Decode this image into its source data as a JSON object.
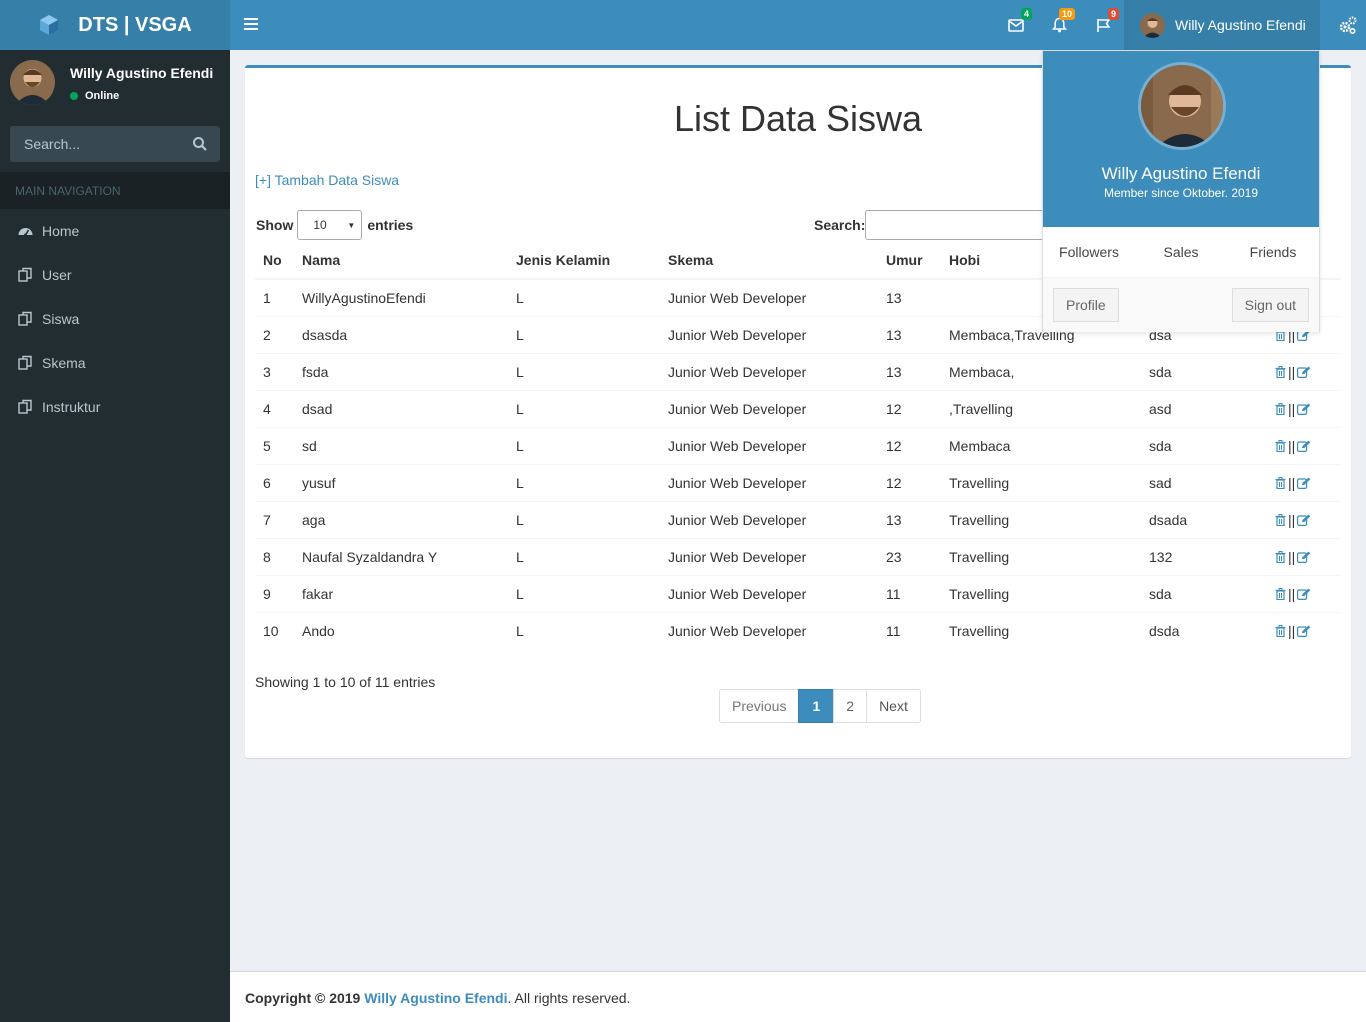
{
  "brand": {
    "title": "DTS | VSGA"
  },
  "header": {
    "badges": {
      "mail": "4",
      "notifications": "10",
      "tasks": "9"
    },
    "user_name": "Willy Agustino Efendi"
  },
  "sidebar": {
    "user_name": "Willy Agustino Efendi",
    "status": "Online",
    "search_placeholder": "Search...",
    "nav_header": "MAIN NAVIGATION",
    "items": [
      {
        "label": "Home",
        "icon": "dashboard-icon"
      },
      {
        "label": "User",
        "icon": "copy-icon"
      },
      {
        "label": "Siswa",
        "icon": "copy-icon"
      },
      {
        "label": "Skema",
        "icon": "copy-icon"
      },
      {
        "label": "Instruktur",
        "icon": "copy-icon"
      }
    ]
  },
  "main": {
    "title": "List Data Siswa",
    "add_link": "[+] Tambah Data Siswa",
    "show_label": "Show",
    "entries_value": "10",
    "entries_label": "entries",
    "search_label": "Search:",
    "columns": [
      "No",
      "Nama",
      "Jenis Kelamin",
      "Skema",
      "Umur",
      "Hobi",
      "",
      ""
    ],
    "rows": [
      [
        "1",
        "WillyAgustinoEfendi",
        "L",
        "Junior Web Developer",
        "13",
        "",
        ""
      ],
      [
        "2",
        "dsasda",
        "L",
        "Junior Web Developer",
        "13",
        "Membaca,Travelling",
        "dsa"
      ],
      [
        "3",
        "fsda",
        "L",
        "Junior Web Developer",
        "13",
        "Membaca,",
        "sda"
      ],
      [
        "4",
        "dsad",
        "L",
        "Junior Web Developer",
        "12",
        ",Travelling",
        "asd"
      ],
      [
        "5",
        "sd",
        "L",
        "Junior Web Developer",
        "12",
        "Membaca",
        "sda"
      ],
      [
        "6",
        "yusuf",
        "L",
        "Junior Web Developer",
        "12",
        "Travelling",
        "sad"
      ],
      [
        "7",
        "aga",
        "L",
        "Junior Web Developer",
        "13",
        "Travelling",
        "dsada"
      ],
      [
        "8",
        "Naufal Syzaldandra Y",
        "L",
        "Junior Web Developer",
        "23",
        "Travelling",
        "132"
      ],
      [
        "9",
        "fakar",
        "L",
        "Junior Web Developer",
        "11",
        "Travelling",
        "sda"
      ],
      [
        "10",
        "Ando",
        "L",
        "Junior Web Developer",
        "11",
        "Travelling",
        "dsda"
      ]
    ],
    "action_separator": "||",
    "info": "Showing 1 to 10 of 11 entries",
    "pagination": {
      "previous": "Previous",
      "pages": [
        "1",
        "2"
      ],
      "next": "Next"
    }
  },
  "dropdown": {
    "name": "Willy Agustino Efendi",
    "since": "Member since Oktober. 2019",
    "links": [
      "Followers",
      "Sales",
      "Friends"
    ],
    "profile": "Profile",
    "signout": "Sign out"
  },
  "footer": {
    "copyright": "Copyright © 2019",
    "author": "Willy Agustino Efendi",
    "rights": ". All rights reserved."
  },
  "colors": {
    "primary": "#3c8dbc",
    "primary_dark": "#367fa9",
    "sidebar": "#222d32",
    "content_bg": "#ecf0f5"
  }
}
